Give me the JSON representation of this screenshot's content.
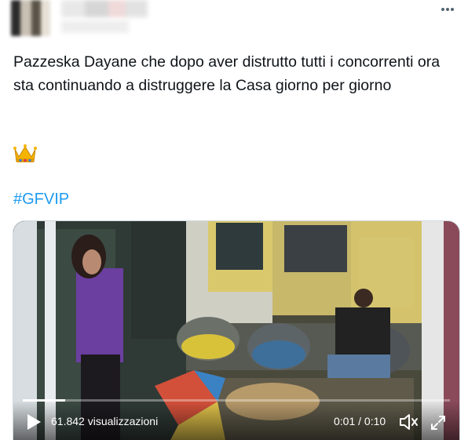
{
  "tweet": {
    "text": "Pazzeska Dayane che dopo aver distrutto tutti i concorrenti ora sta continuando a distruggere la Casa giorno per giorno",
    "emoji": "crown-icon",
    "hashtag": "#GFVIP"
  },
  "video": {
    "views": "61.842 visualizzazioni",
    "time": "0:01 / 0:10",
    "progress": 0.1,
    "controls": {
      "play": "play-icon",
      "volume": "volume-icon",
      "fullscreen": "fullscreen-icon"
    }
  },
  "colors": {
    "text": "#0f1419",
    "hashtag": "#1d9bf0",
    "border": "#cfd9de",
    "icon": "#536471"
  }
}
